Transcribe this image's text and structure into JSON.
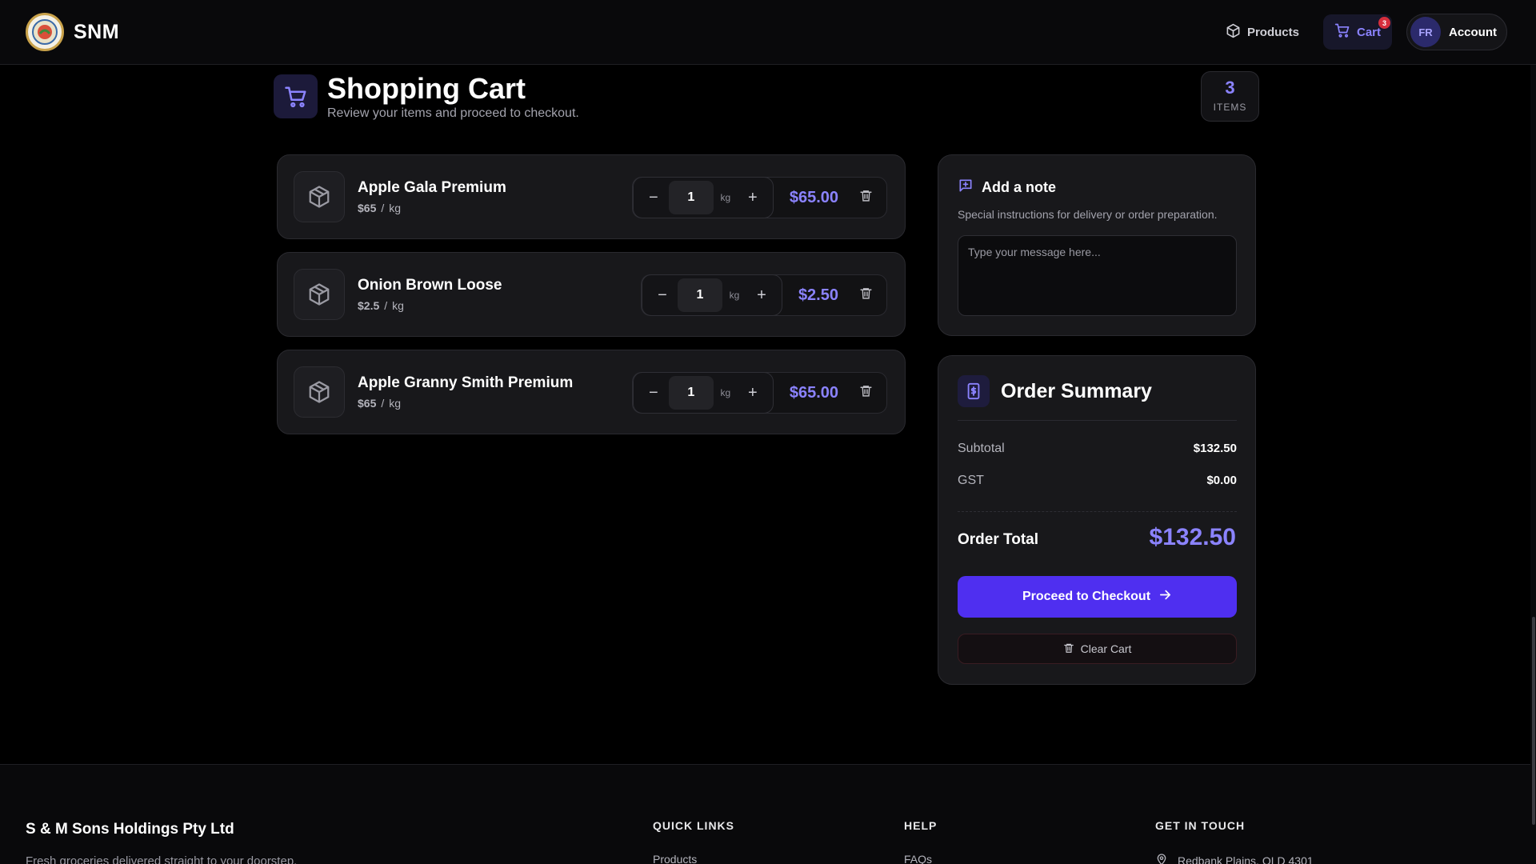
{
  "header": {
    "brand": "SNM",
    "nav_products": "Products",
    "nav_cart": "Cart",
    "cart_badge": "3",
    "avatar_initials": "FR",
    "nav_account": "Account"
  },
  "page": {
    "title": "Shopping Cart",
    "subtitle": "Review your items and proceed to checkout.",
    "items_count": "3",
    "items_label": "ITEMS"
  },
  "cart_items": [
    {
      "name": "Apple Gala Premium",
      "unit_price": "$65",
      "unit": "kg",
      "qty": "1",
      "qty_unit": "kg",
      "total": "$65.00"
    },
    {
      "name": "Onion Brown Loose",
      "unit_price": "$2.5",
      "unit": "kg",
      "qty": "1",
      "qty_unit": "kg",
      "total": "$2.50"
    },
    {
      "name": "Apple Granny Smith Premium",
      "unit_price": "$65",
      "unit": "kg",
      "qty": "1",
      "qty_unit": "kg",
      "total": "$65.00"
    }
  ],
  "note": {
    "title": "Add a note",
    "description": "Special instructions for delivery or order preparation.",
    "placeholder": "Type your message here..."
  },
  "summary": {
    "title": "Order Summary",
    "subtotal_label": "Subtotal",
    "subtotal_value": "$132.50",
    "gst_label": "GST",
    "gst_value": "$0.00",
    "total_label": "Order Total",
    "total_value": "$132.50",
    "checkout_label": "Proceed to Checkout",
    "clear_label": "Clear Cart"
  },
  "footer": {
    "company": "S & M Sons Holdings Pty Ltd",
    "tagline": "Fresh groceries delivered straight to your doorstep.",
    "quick_links_heading": "QUICK LINKS",
    "quick_links": [
      "Products"
    ],
    "help_heading": "HELP",
    "help_links": [
      "FAQs"
    ],
    "contact_heading": "GET IN TOUCH",
    "address": "Redbank Plains, QLD 4301"
  },
  "colors": {
    "accent": "#8b83ff",
    "primary_button": "#4f2ff0",
    "badge": "#d62e3c",
    "background": "#000000",
    "card": "#18181b"
  }
}
